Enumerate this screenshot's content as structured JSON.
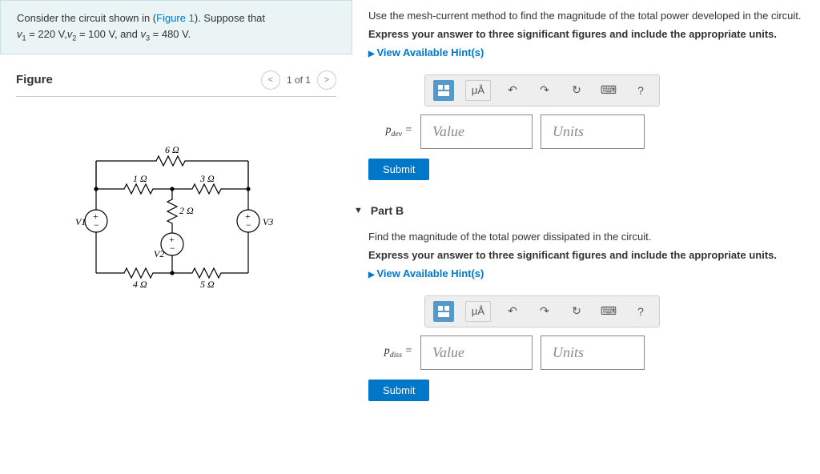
{
  "problem": {
    "text_prefix": "Consider the circuit shown in (",
    "figure_link": "Figure 1",
    "text_middle": "). Suppose that ",
    "v1_label": "v",
    "v1_sub": "1",
    "v1_val": " = 220 V,",
    "v2_label": "v",
    "v2_sub": "2",
    "v2_val": " = 100 V, and ",
    "v3_label": "v",
    "v3_sub": "3",
    "v3_val": " = 480 V."
  },
  "figure": {
    "title": "Figure",
    "nav_text": "1 of 1",
    "r_6": "6 Ω",
    "r_1": "1 Ω",
    "r_3": "3 Ω",
    "r_2": "2 Ω",
    "r_4": "4 Ω",
    "r_5": "5 Ω",
    "v1": "V1",
    "v2": "V2",
    "v3": "V3"
  },
  "partA": {
    "prompt": "Use the mesh-current method to find the magnitude of the total power developed in the circuit.",
    "instruction": "Express your answer to three significant figures and include the appropriate units.",
    "hints": "View Available Hint(s)",
    "greek_label": "μÅ",
    "var_label": "p",
    "var_sub": "dev",
    "equals": " = ",
    "value_ph": "Value",
    "units_ph": "Units",
    "submit": "Submit"
  },
  "partB": {
    "title": "Part B",
    "prompt": "Find the magnitude of the total power dissipated in the circuit.",
    "instruction": "Express your answer to three significant figures and include the appropriate units.",
    "hints": "View Available Hint(s)",
    "greek_label": "μÅ",
    "var_label": "p",
    "var_sub": "diss",
    "equals": " = ",
    "value_ph": "Value",
    "units_ph": "Units",
    "submit": "Submit"
  },
  "icons": {
    "undo": "↶",
    "redo": "↷",
    "reset": "↻",
    "keyboard": "⌨",
    "help": "?"
  }
}
